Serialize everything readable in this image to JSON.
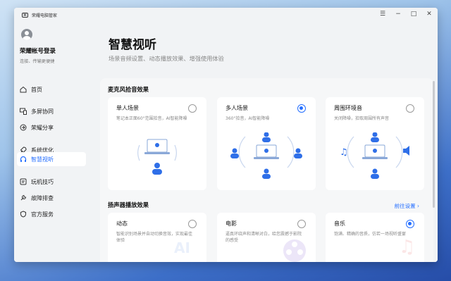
{
  "app": {
    "title": "荣耀电脑管家"
  },
  "account": {
    "name": "荣耀帐号登录",
    "subtitle": "连接、传输更便捷"
  },
  "sidebar": {
    "items": [
      {
        "label": "首页",
        "icon": "home-icon"
      },
      {
        "label": "多屏协同",
        "icon": "multiscreen-icon"
      },
      {
        "label": "荣耀分享",
        "icon": "share-icon"
      },
      {
        "label": "系统优化",
        "icon": "rocket-icon"
      },
      {
        "label": "智慧视听",
        "icon": "headphones-icon"
      },
      {
        "label": "玩机技巧",
        "icon": "tips-icon"
      },
      {
        "label": "故障排查",
        "icon": "troubleshoot-icon"
      },
      {
        "label": "官方服务",
        "icon": "service-icon"
      }
    ],
    "active_index": 4
  },
  "window_controls": {
    "menu": "☰",
    "minimize": "−",
    "maximize": "□",
    "close": "✕"
  },
  "page": {
    "title": "智慧视听",
    "subtitle": "场景音频设置、动态播放效果、增强使用体验"
  },
  "mic_section": {
    "title": "麦克风拾音效果",
    "cards": [
      {
        "title": "单人场景",
        "desc": "笔记本正面60°范围拾音，AI智能降噪",
        "selected": false
      },
      {
        "title": "多人场景",
        "desc": "360°拾音，AI智能降噪",
        "selected": true
      },
      {
        "title": "周围环境音",
        "desc": "关闭降噪，拾取周围所有声音",
        "selected": false
      }
    ]
  },
  "speaker_section": {
    "title": "扬声器播放效果",
    "more_link": "前往设置 ›",
    "cards": [
      {
        "title": "动态",
        "desc": "智能识别场景并自动切换音效，实现最佳体验",
        "selected": false
      },
      {
        "title": "电影",
        "desc": "逼真环绕声和清晰对白，给您震撼于影院的感受",
        "selected": false
      },
      {
        "title": "音乐",
        "desc": "饱满、精确的音质，仿若一场视听盛宴",
        "selected": true
      }
    ]
  },
  "colors": {
    "accent": "#256fff",
    "person": "#2f6fe8"
  }
}
